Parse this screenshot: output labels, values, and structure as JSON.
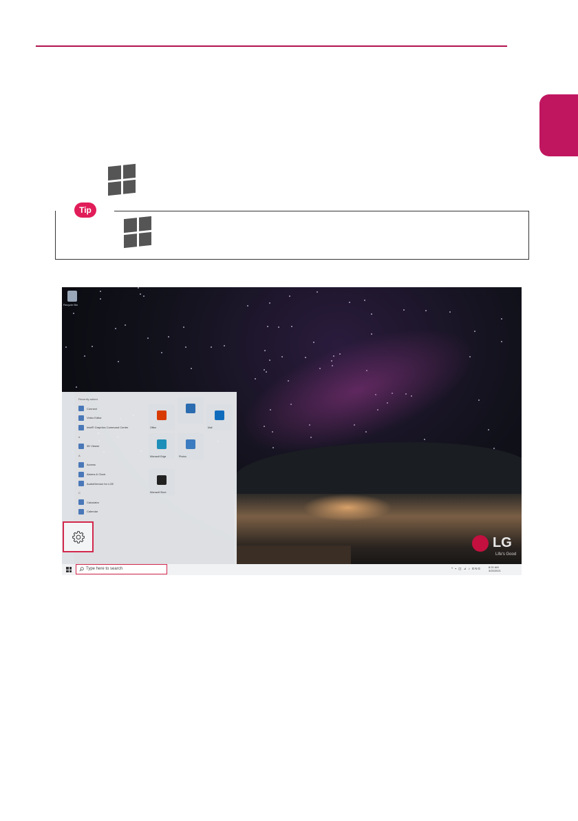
{
  "doc": {
    "tip_label": "Tip"
  },
  "screenshot": {
    "desktop": {
      "recycle_bin_label": "Recycle Bin"
    },
    "brand": {
      "logo_text": "LG",
      "tagline": "Life's Good"
    },
    "start_menu": {
      "list": [
        {
          "label": "Recently added",
          "type": "header"
        },
        {
          "label": "Connect",
          "type": "app"
        },
        {
          "label": "Video Editor",
          "type": "app"
        },
        {
          "label": "Intel® Graphics Command Center",
          "type": "app"
        },
        {
          "label": "#",
          "type": "letter"
        },
        {
          "label": "3D Viewer",
          "type": "app"
        },
        {
          "label": "A",
          "type": "letter"
        },
        {
          "label": "Access",
          "type": "app"
        },
        {
          "label": "Alarms & Clock",
          "type": "app"
        },
        {
          "label": "AudioDirector for LGE",
          "type": "app"
        },
        {
          "label": "C",
          "type": "letter"
        },
        {
          "label": "Calculator",
          "type": "app"
        },
        {
          "label": "Calendar",
          "type": "app"
        }
      ],
      "tiles": [
        {
          "label": "Office",
          "color": "#d83b01"
        },
        {
          "label": "",
          "color": "#2b6cb0"
        },
        {
          "label": "Mail",
          "color": "#0f6cbd"
        },
        {
          "label": "Microsoft Edge",
          "color": "#1d8fb8"
        },
        {
          "label": "Photos",
          "color": "#3b7bbf"
        },
        {
          "label": "Microsoft Store",
          "color": "#222222"
        }
      ],
      "settings_icon": "gear-icon"
    },
    "taskbar": {
      "search_placeholder": "Type here to search",
      "tray_text": "^ ▪ ◫ ⊿ ♪ ENG",
      "time": "8:21 AM",
      "date": "3/20/2021"
    }
  }
}
